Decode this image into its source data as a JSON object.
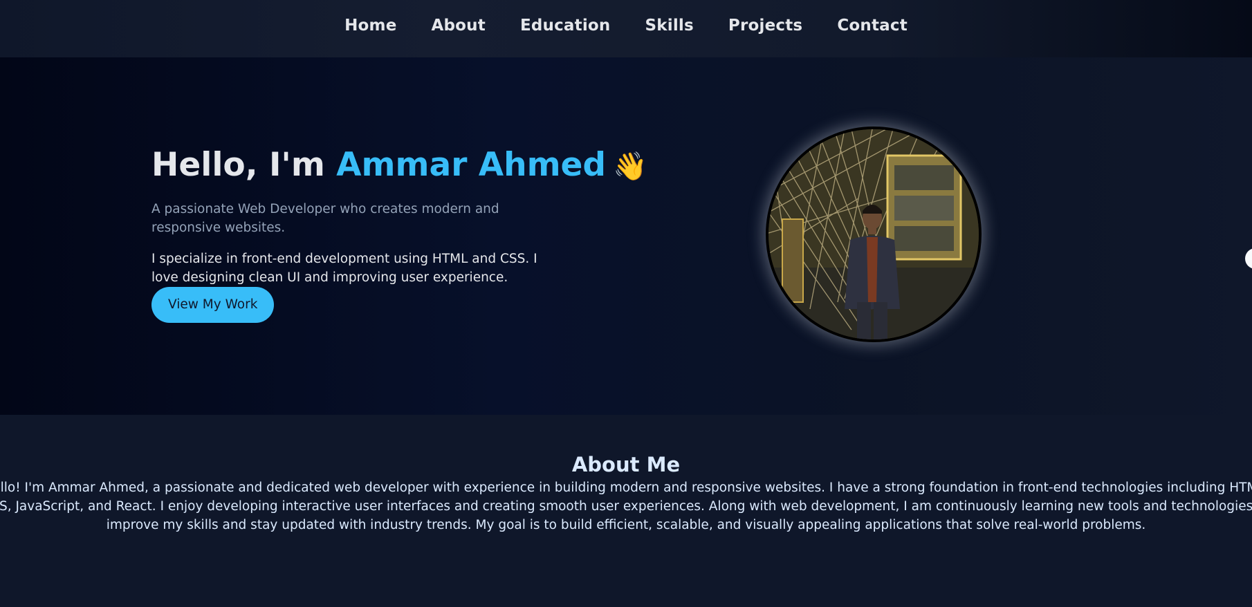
{
  "nav": {
    "items": [
      {
        "label": "Home"
      },
      {
        "label": "About"
      },
      {
        "label": "Education"
      },
      {
        "label": "Skills"
      },
      {
        "label": "Projects"
      },
      {
        "label": "Contact"
      }
    ]
  },
  "hero": {
    "greeting": "Hello, I'm",
    "name": "Ammar Ahmed",
    "wave_emoji": "👋",
    "subtitle": "A passionate Web Developer who creates modern and responsive websites.",
    "description": "I specialize in front-end development using HTML and CSS. I love designing clean UI and improving user experience.",
    "cta_label": "View My Work",
    "photo_icon": "profile-photo",
    "accent_color": "#38bdf8"
  },
  "about": {
    "title": "About Me",
    "body": "Hello! I'm Ammar Ahmed, a passionate and dedicated web developer with experience in building modern and responsive websites. I have a strong foundation in front-end technologies including HTML, CSS, JavaScript, and React. I enjoy developing interactive user interfaces and creating smooth user experiences. Along with web development, I am continuously learning new tools and technologies to improve my skills and stay updated with industry trends. My goal is to build efficient, scalable, and visually appealing applications that solve real-world problems."
  }
}
